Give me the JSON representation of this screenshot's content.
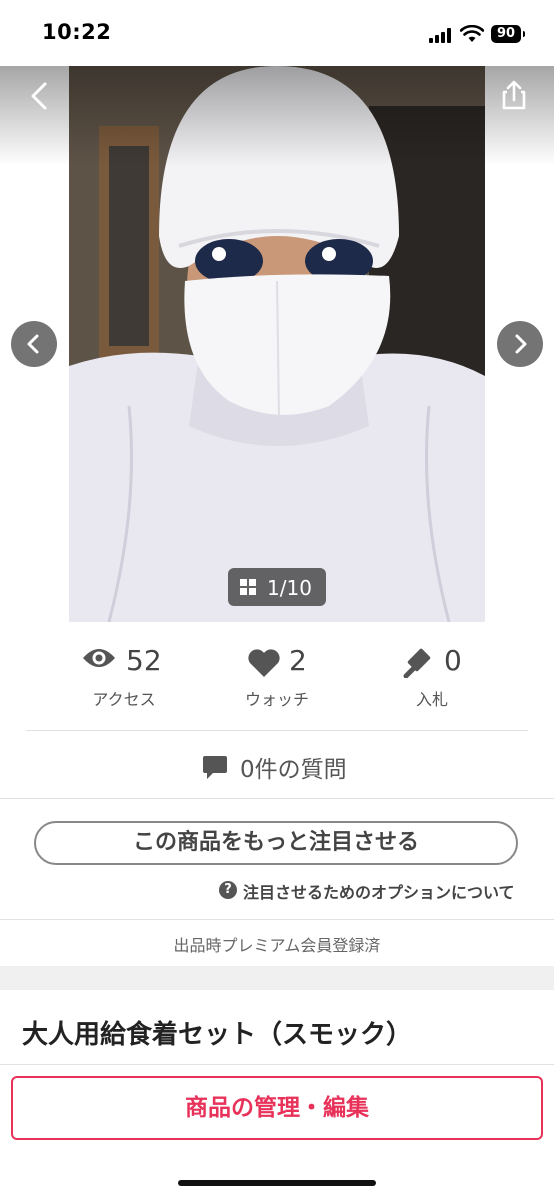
{
  "status_bar": {
    "time": "10:22",
    "battery": "90"
  },
  "gallery": {
    "counter": "1/10"
  },
  "stats": {
    "views": {
      "value": "52",
      "label": "アクセス"
    },
    "watch": {
      "value": "2",
      "label": "ウォッチ"
    },
    "bids": {
      "value": "0",
      "label": "入札"
    }
  },
  "questions": {
    "label": "0件の質問"
  },
  "promote": {
    "button_label": "この商品をもっと注目させる",
    "help_label": "注目させるためのオプションについて"
  },
  "premium_note": "出品時プレミアム会員登録済",
  "item": {
    "title": "大人用給食着セット（スモック）"
  },
  "manage_button": "商品の管理・編集",
  "colors": {
    "accent": "#e8325a",
    "text": "#333333",
    "muted": "#555555"
  },
  "icons": [
    "back-icon",
    "share-icon",
    "chevron-left-icon",
    "chevron-right-icon",
    "grid-icon",
    "eye-icon",
    "heart-icon",
    "gavel-icon",
    "speech-bubble-icon",
    "question-icon"
  ]
}
